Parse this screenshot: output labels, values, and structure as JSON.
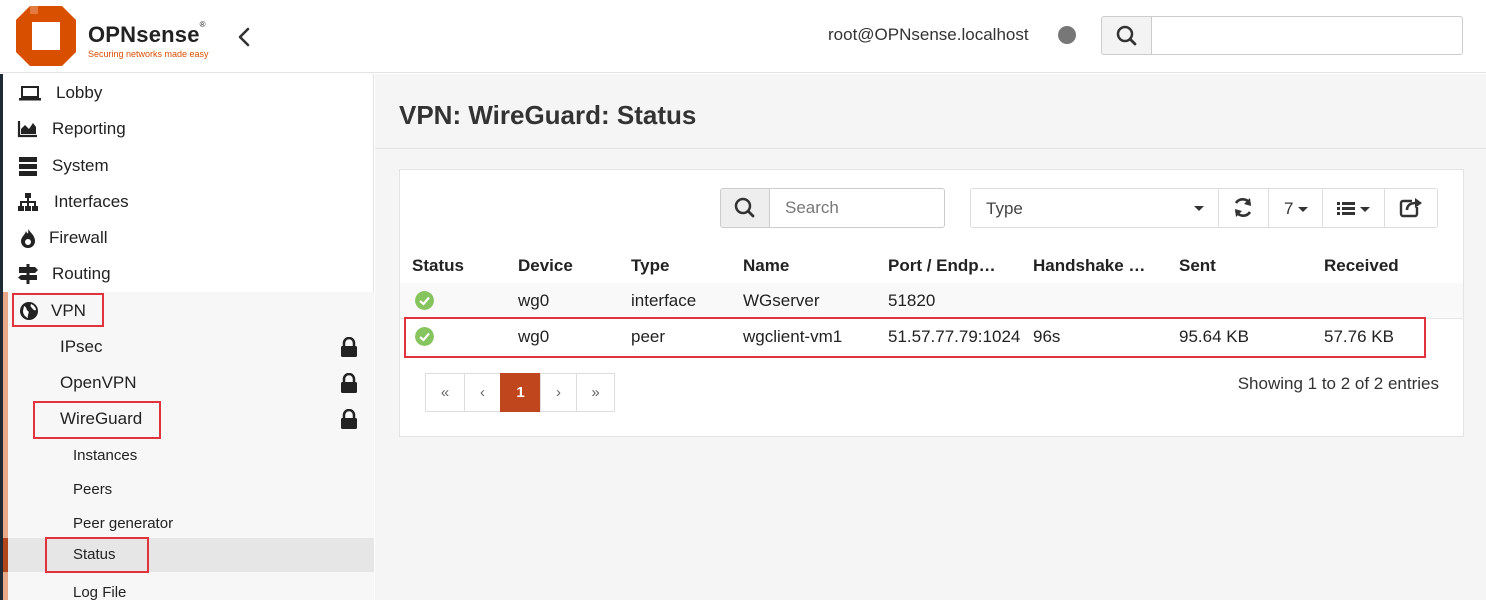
{
  "header": {
    "brand": "OPNsense",
    "brand_mark": "®",
    "tagline": "Securing networks made easy",
    "user": "root@OPNsense.localhost",
    "search_value": ""
  },
  "sidebar": {
    "items": [
      {
        "label": "Lobby",
        "icon": "laptop-icon"
      },
      {
        "label": "Reporting",
        "icon": "area-chart-icon"
      },
      {
        "label": "System",
        "icon": "server-icon"
      },
      {
        "label": "Interfaces",
        "icon": "sitemap-icon"
      },
      {
        "label": "Firewall",
        "icon": "fire-icon"
      },
      {
        "label": "Routing",
        "icon": "signpost-icon"
      },
      {
        "label": "VPN",
        "icon": "globe-icon"
      }
    ],
    "vpn_children": [
      {
        "label": "IPsec",
        "locked": true
      },
      {
        "label": "OpenVPN",
        "locked": true
      },
      {
        "label": "WireGuard",
        "locked": true
      }
    ],
    "wireguard_children": [
      "Instances",
      "Peers",
      "Peer generator",
      "Status",
      "Log File"
    ]
  },
  "page": {
    "title": "VPN: WireGuard: Status"
  },
  "toolbar": {
    "search_placeholder": "Search",
    "type_select": "Type",
    "page_size": "7"
  },
  "table": {
    "headers": [
      "Status",
      "Device",
      "Type",
      "Name",
      "Port / Endp…",
      "Handshake …",
      "Sent",
      "Received"
    ],
    "rows": [
      {
        "device": "wg0",
        "type": "interface",
        "name": "WGserver",
        "endpoint": "51820",
        "handshake": "",
        "sent": "",
        "received": ""
      },
      {
        "device": "wg0",
        "type": "peer",
        "name": "wgclient-vm1",
        "endpoint": "51.57.77.79:1024",
        "handshake": "96s",
        "sent": "95.64 KB",
        "received": "57.76 KB"
      }
    ]
  },
  "pagination": {
    "first": "«",
    "prev": "‹",
    "current": "1",
    "next": "›",
    "last": "»",
    "summary": "Showing 1 to 2 of 2 entries"
  },
  "colors": {
    "accent": "#d94f00",
    "active_page": "#c0461e",
    "ok": "#86c45e",
    "highlight_box": "#e0333d"
  }
}
